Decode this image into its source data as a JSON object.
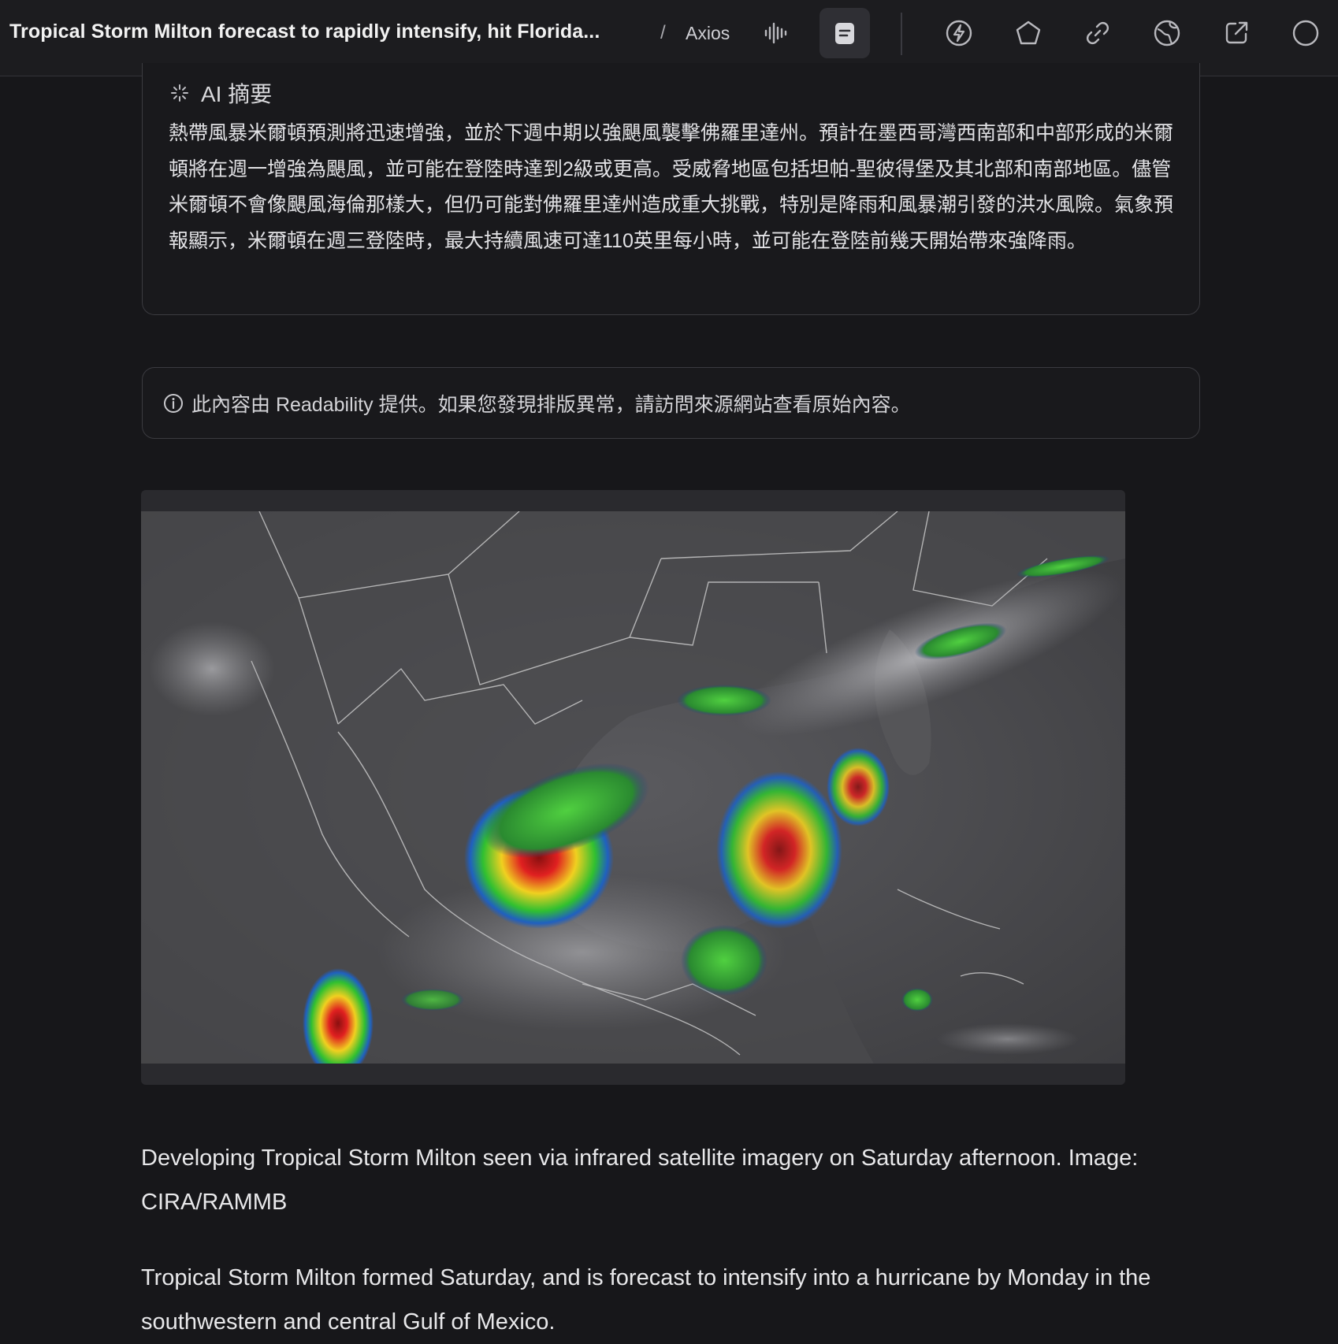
{
  "header": {
    "title": "Tropical Storm Milton forecast to rapidly intensify, hit Florida...",
    "separator": "/",
    "source": "Axios",
    "icons": [
      "audio-waveform-icon",
      "reader-mode-icon",
      "bolt-icon",
      "pentagon-icon",
      "link-icon",
      "globe-icon",
      "external-link-icon",
      "circle-icon"
    ]
  },
  "ai_summary": {
    "heading": "AI 摘要",
    "text": "熱帶風暴米爾頓預測將迅速增強，並於下週中期以強颶風襲擊佛羅里達州。預計在墨西哥灣西南部和中部形成的米爾頓將在週一增強為颶風，並可能在登陸時達到2級或更高。受威脅地區包括坦帕-聖彼得堡及其北部和南部地區。儘管米爾頓不會像颶風海倫那樣大，但仍可能對佛羅里達州造成重大挑戰，特別是降雨和風暴潮引發的洪水風險。氣象預報顯示，米爾頓在週三登陸時，最大持續風速可達110英里每小時，並可能在登陸前幾天開始帶來強降雨。"
  },
  "notice": {
    "text": "此內容由 Readability 提供。如果您發現排版異常，請訪問來源網站查看原始內容。"
  },
  "article": {
    "caption": "Developing Tropical Storm Milton seen via infrared satellite imagery on Saturday afternoon. Image: CIRA/RAMMB",
    "paragraph": "Tropical Storm Milton formed Saturday, and is forecast to intensify into a hurricane by Monday in the southwestern and central Gulf of Mexico."
  }
}
